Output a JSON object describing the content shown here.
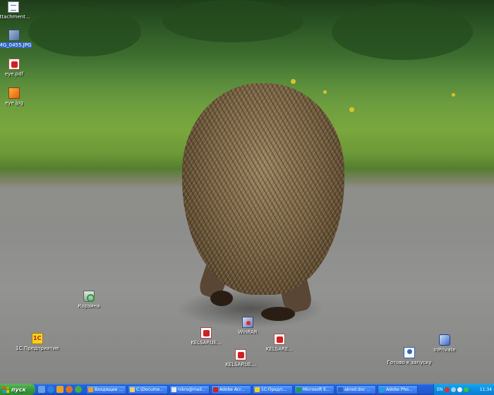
{
  "desktop": {
    "icons": [
      {
        "id": "attachment",
        "label": "attachment...",
        "icon": "word-document-icon",
        "selected": false
      },
      {
        "id": "img0455",
        "label": "IMG_0455.JPG",
        "icon": "jpeg-image-icon",
        "selected": true
      },
      {
        "id": "eyepdf",
        "label": "eye.pdf",
        "icon": "pdf-document-icon",
        "selected": false
      },
      {
        "id": "eyejpg",
        "label": "eye.jpg",
        "icon": "jpeg-image-icon",
        "selected": false
      },
      {
        "id": "bin",
        "label": "Корзина",
        "icon": "recycle-bin-icon",
        "selected": false
      },
      {
        "id": "onec",
        "label": "1С Предприятие",
        "icon": "1c-enterprise-icon",
        "selected": false
      },
      {
        "id": "winrar",
        "label": "WinRAR",
        "icon": "winrar-icon",
        "selected": false
      },
      {
        "id": "kelsa1",
        "label": "KELSARUE...",
        "icon": "pdf-document-icon",
        "selected": false
      },
      {
        "id": "kelsa2",
        "label": "KELSARE...",
        "icon": "pdf-document-icon",
        "selected": false
      },
      {
        "id": "kelsa3",
        "label": "KELSARUE...",
        "icon": "pdf-document-icon",
        "selected": false
      },
      {
        "id": "network",
        "label": "Готово к запуску",
        "icon": "network-icon",
        "selected": false
      },
      {
        "id": "ie",
        "label": "InPrivate",
        "icon": "application-icon",
        "selected": false
      }
    ]
  },
  "taskbar": {
    "start_label": "пуск",
    "quick_launch": [
      "show-desktop-icon",
      "internet-explorer-icon",
      "outlook-icon",
      "media-player-icon",
      "messenger-icon"
    ],
    "buttons": [
      {
        "label": "Входящие ...",
        "icon": "outlook-icon",
        "color": "#f0a020"
      },
      {
        "label": "C:\\Docume...",
        "icon": "folder-icon",
        "color": "#f0d060"
      },
      {
        "label": "nikro@mail...",
        "icon": "mail-icon",
        "color": "#e8e8f0"
      },
      {
        "label": "Adobe Acr...",
        "icon": "acrobat-icon",
        "color": "#d02020"
      },
      {
        "label": "1С:Предп...",
        "icon": "1c-icon",
        "color": "#f6d020"
      },
      {
        "label": "Microsoft E...",
        "icon": "excel-icon",
        "color": "#20a040"
      },
      {
        "label": "akred.doc ...",
        "icon": "word-icon",
        "color": "#3060c0"
      },
      {
        "label": "Adobe Pho...",
        "icon": "photoshop-icon",
        "color": "#20a0e0"
      }
    ],
    "tray": {
      "language": "EN",
      "clock": "11:34",
      "icons": [
        "antivirus-icon",
        "network-tray-icon",
        "volume-icon",
        "messenger-tray-icon"
      ]
    }
  },
  "colors": {
    "taskbar": "#2158d2",
    "start_button": "#3a9a3a",
    "tray": "#0f8ee0",
    "selection": "#316ac5"
  }
}
